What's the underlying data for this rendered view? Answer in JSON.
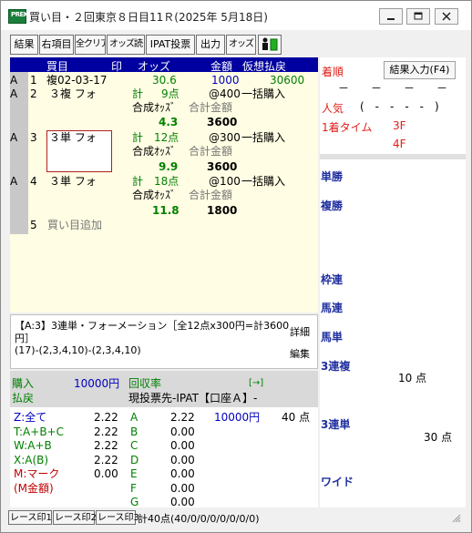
{
  "window": {
    "title": "買い目・２回東京８日目11Ｒ(2025年 5月18日)",
    "app_icon_text": "PREK"
  },
  "toolbar": {
    "buttons": [
      "結果",
      "右項目",
      "全クリア",
      "オッズ読",
      "IPAT投票",
      "出力",
      "オッズ"
    ]
  },
  "bets": {
    "header": {
      "col_mark": "買目",
      "col_in": "印",
      "col_odds": "オッズ",
      "col_amount": "金額",
      "col_payout": "仮想払戻"
    },
    "row1": {
      "kind": "A",
      "num": "1",
      "bet": "複02-03-17",
      "odds": "30.6",
      "amount": "1000",
      "payout": "30600"
    },
    "row2": {
      "kind": "A",
      "num": "2",
      "bet": "３複 フォ",
      "count_label": "計",
      "count": "9点",
      "unit": "@400",
      "buy": "一括購入",
      "synth_label": "合成ｵｯｽﾞ",
      "total_label": "合計金額",
      "synth": "4.3",
      "total": "3600"
    },
    "row3": {
      "kind": "A",
      "num": "3",
      "bet": "３単 フォ",
      "count_label": "計",
      "count": "12点",
      "unit": "@300",
      "buy": "一括購入",
      "synth_label": "合成ｵｯｽﾞ",
      "total_label": "合計金額",
      "synth": "9.9",
      "total": "3600"
    },
    "row4": {
      "kind": "A",
      "num": "4",
      "bet": "３単 フォ",
      "count_label": "計",
      "count": "18点",
      "unit": "@100",
      "buy": "一括購入",
      "synth_label": "合成ｵｯｽﾞ",
      "total_label": "合計金額",
      "synth": "11.8",
      "total": "1800"
    },
    "row5": {
      "num": "5",
      "label": "買い目追加"
    }
  },
  "detail": {
    "line1": "【A:3】3連単・フォーメーション［全12点x300円=計3600",
    "line2": "円］",
    "line3": "(17)-(2,3,4,10)-(2,3,4,10)",
    "detail_button": "詳細",
    "edit_button": "編集"
  },
  "summary": {
    "purchase_label": "購入",
    "purchase_value": "10000円",
    "recovery_label": "回収率",
    "arrow": "[→]",
    "payout_label": "払戻",
    "dest": "現投票先-IPAT【口座Ａ】-",
    "marks": [
      {
        "key": "Z:全て",
        "odds": "2.22",
        "letter": "A",
        "val": "2.22",
        "amount": "10000円",
        "points": "40 点"
      },
      {
        "key": "T:A+B+C",
        "odds": "2.22",
        "letter": "B",
        "val": "0.00"
      },
      {
        "key": "W:A+B",
        "odds": "2.22",
        "letter": "C",
        "val": "0.00"
      },
      {
        "key": "X:A(B)",
        "odds": "2.22",
        "letter": "D",
        "val": "0.00"
      },
      {
        "key": "M:マーク",
        "odds": "0.00",
        "letter": "E",
        "val": "0.00"
      },
      {
        "key": "(M金額)",
        "odds": "",
        "letter": "F",
        "val": "0.00"
      },
      {
        "key": "",
        "odds": "",
        "letter": "G",
        "val": "0.00"
      }
    ]
  },
  "right": {
    "arrival_label": "着順",
    "result_button": "結果入力(F4)",
    "dashes": "－　　－　　－　　－",
    "popularity_label": "人気",
    "popularity_value": "(　-　-　-　-　)",
    "first_time_label": "1着タイム",
    "f3": "3F",
    "f4": "4F",
    "tansho": "単勝",
    "fukusho": "複勝",
    "wakuren": "枠連",
    "umaren": "馬連",
    "umatan": "馬単",
    "sanrenpuku": "3連複",
    "sanrenpuku_points": "10 点",
    "sanrentan": "3連単",
    "sanrentan_points": "30 点",
    "wide": "ワイド"
  },
  "status": {
    "tabs": [
      "レース印1",
      "レース印2",
      "レース印3"
    ],
    "text": "計40点(40/0/0/0/0/0/0/0)"
  },
  "colors": {
    "header_blue": "#0000a0",
    "panel_yellow": "#fffde3",
    "green_text": "#008000",
    "red_text": "#e0201a",
    "label_blue": "#1f2f9f"
  }
}
